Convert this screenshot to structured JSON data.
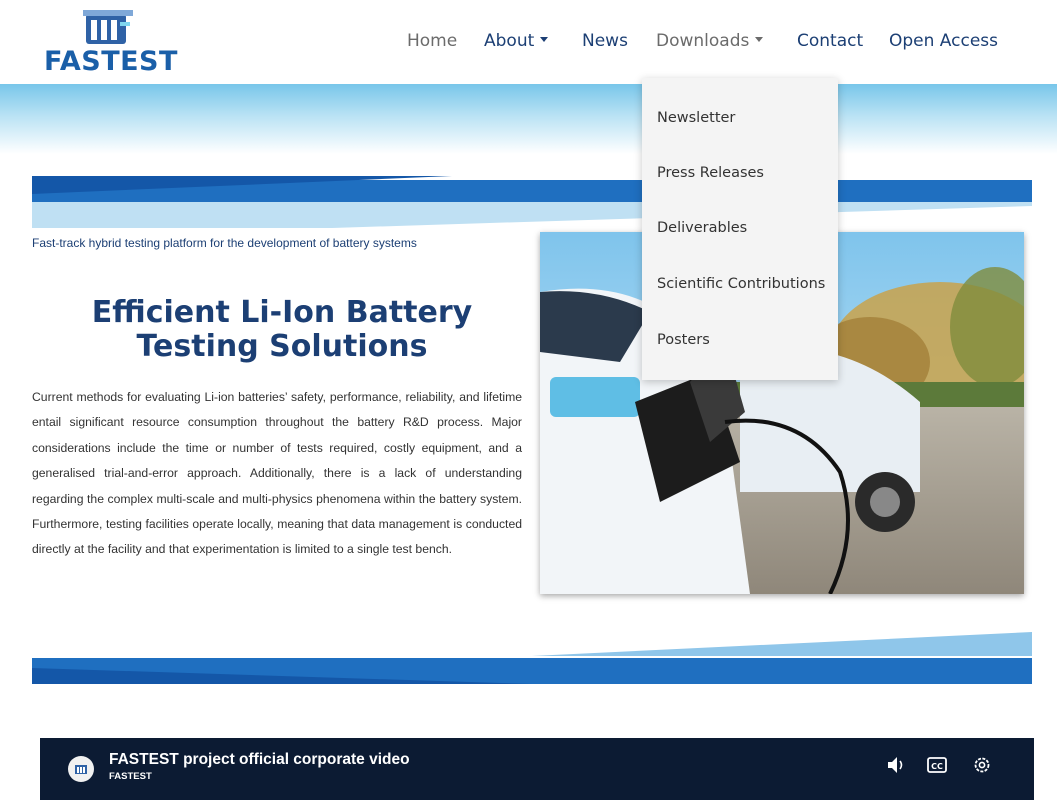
{
  "brand": {
    "name": "FASTEST",
    "logo_color": "#1a5fa8"
  },
  "nav": {
    "items": [
      {
        "label": "Home",
        "has_caret": false
      },
      {
        "label": "About",
        "has_caret": true
      },
      {
        "label": "News",
        "has_caret": false
      },
      {
        "label": "Downloads",
        "has_caret": true
      },
      {
        "label": "Contact",
        "has_caret": false
      },
      {
        "label": "Open Access",
        "has_caret": false
      }
    ],
    "active_color": "#1c3f74",
    "muted_color": "#6b6b6b"
  },
  "downloads_menu": {
    "open": true,
    "items": [
      "Newsletter",
      "Press Releases",
      "Deliverables",
      "Scientific Contributions",
      "Posters"
    ]
  },
  "hero": {
    "tagline": "Fast-track hybrid testing platform for the development of battery systems",
    "heading_line1": "Efficient Li-Ion Battery",
    "heading_line2": "Testing Solutions",
    "body": "Current methods for evaluating Li-ion batteries’ safety, performance, reliability, and lifetime entail significant resource consumption throughout the battery R&D process. Major considerations include the time or number of tests required, costly equipment, and a generalised trial-and-error approach. Additionally, there is a lack of understanding regarding the complex multi-scale and multi-physics phenomena within the battery system. Furthermore, testing facilities operate locally, meaning that data management is conducted directly at the facility and that experimentation is limited to a single test bench.",
    "image": "electric-car-charging-photo"
  },
  "video": {
    "title": "FASTEST project official corporate video",
    "channel": "FASTEST",
    "controls": [
      "volume-icon",
      "captions-icon",
      "settings-icon"
    ]
  },
  "colors": {
    "navy": "#1c3f74",
    "blue": "#1f6fc0",
    "light_blue": "#8fc6ea",
    "video_bg": "#0c1b33"
  }
}
